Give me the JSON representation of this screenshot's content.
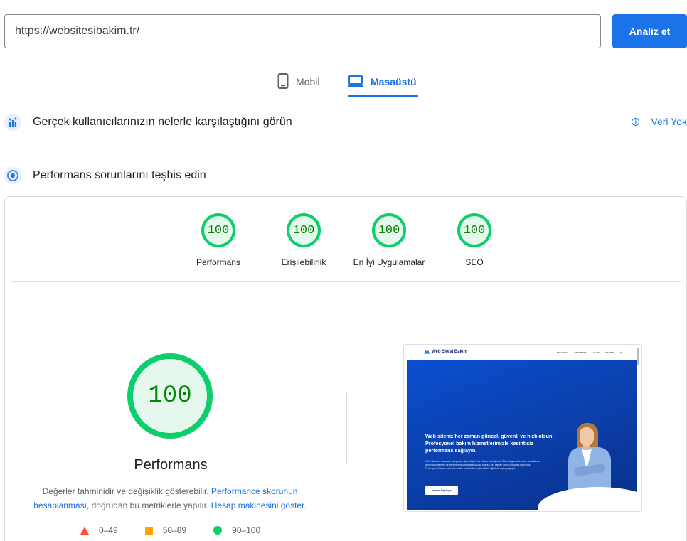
{
  "url_bar": {
    "value": "https://websitesibakim.tr/",
    "analyze_label": "Analiz et"
  },
  "tabs": [
    {
      "label": "Mobil",
      "icon": "smartphone-icon",
      "active": false
    },
    {
      "label": "Masaüstü",
      "icon": "laptop-icon",
      "active": true
    }
  ],
  "crux": {
    "title": "Gerçek kullanıcılarınızın nelerle karşılaştığını görün",
    "status": "Veri Yok",
    "status_icon": "info-icon"
  },
  "diagnose": {
    "title": "Performans sorunlarını teşhis edin"
  },
  "scores": [
    {
      "value": "100",
      "label": "Performans"
    },
    {
      "value": "100",
      "label": "Erişilebilirlik"
    },
    {
      "value": "100",
      "label": "En İyi Uygulamalar"
    },
    {
      "value": "100",
      "label": "SEO"
    }
  ],
  "main_score": {
    "value": "100",
    "label": "Performans"
  },
  "note": {
    "text1": "Değerler tahminidir ve değişiklik gösterebilir.",
    "link1": "Performance skorunun hesaplanması",
    "text2": ", doğrudan bu metriklerle yapılır.",
    "link2": "Hesap makinesini göster."
  },
  "legend": [
    {
      "range": "0–49",
      "shape": "triangle",
      "color": "#ff4e42"
    },
    {
      "range": "50–89",
      "shape": "square",
      "color": "#ffa400"
    },
    {
      "range": "90–100",
      "shape": "circle",
      "color": "#0cce6b"
    }
  ],
  "screenshot": {
    "logo": "Web Sitesi Bakım",
    "menu": [
      "ANA SAYFA",
      "HAKKIMIZDA",
      "BLOG",
      "İLETİŞİM"
    ],
    "headline": "Web siteniz her zaman güncel, güvenli ve hızlı olsun! Profesyonel bakım hizmetlerimizle kesintisiz performans sağlayın.",
    "body": "Web sitenizin sorunsuz çalışması, güvenliği ve hızı bizim önceliğimiz! Düzenli güncellemeler, yedekleme, güvenlik önlemleri ve performans optimizasyonu ile sitenizi her zaman en iyi durumda tutuyoruz. Profesyonel bakım hizmetlerimizle kesintisiz ve güvenli bir dijital deneyim yaşayın.",
    "cta": "Hemen Başlayın"
  },
  "colors": {
    "accent": "#1a73e8",
    "pass": "#0cce6b",
    "average": "#ffa400",
    "fail": "#ff4e42"
  }
}
